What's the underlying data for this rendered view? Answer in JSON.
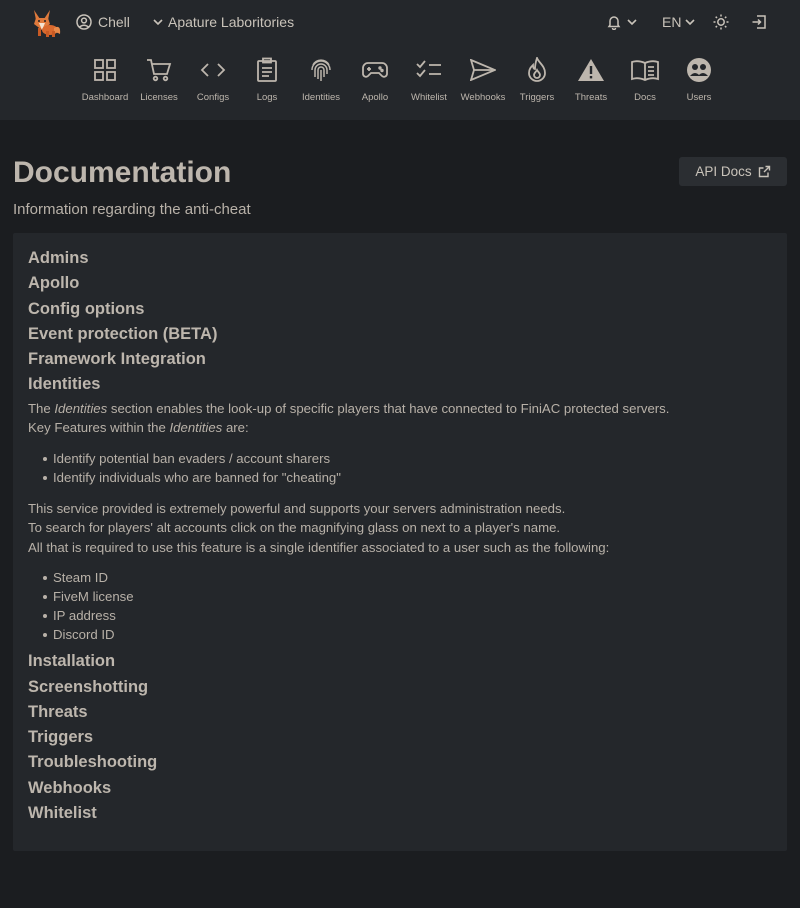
{
  "header": {
    "user_name": "Chell",
    "org_name": "Apature Laboritories",
    "language": "EN"
  },
  "nav": [
    {
      "key": "dashboard",
      "label": "Dashboard",
      "icon": "grid-icon"
    },
    {
      "key": "licenses",
      "label": "Licenses",
      "icon": "cart-icon"
    },
    {
      "key": "configs",
      "label": "Configs",
      "icon": "code-icon"
    },
    {
      "key": "logs",
      "label": "Logs",
      "icon": "clipboard-icon"
    },
    {
      "key": "identities",
      "label": "Identities",
      "icon": "fingerprint-icon"
    },
    {
      "key": "apollo",
      "label": "Apollo",
      "icon": "gamepad-icon"
    },
    {
      "key": "whitelist",
      "label": "Whitelist",
      "icon": "checklist-icon"
    },
    {
      "key": "webhooks",
      "label": "Webhooks",
      "icon": "send-icon"
    },
    {
      "key": "triggers",
      "label": "Triggers",
      "icon": "flame-icon"
    },
    {
      "key": "threats",
      "label": "Threats",
      "icon": "warning-icon"
    },
    {
      "key": "docs",
      "label": "Docs",
      "icon": "book-icon"
    },
    {
      "key": "users",
      "label": "Users",
      "icon": "users-icon"
    }
  ],
  "page": {
    "title": "Documentation",
    "subtitle": "Information regarding the anti-cheat",
    "api_docs_label": "API Docs"
  },
  "sections_before": [
    "Admins",
    "Apollo",
    "Config options",
    "Event protection (BETA)",
    "Framework Integration"
  ],
  "expanded": {
    "title": "Identities",
    "p1_pre": "The ",
    "p1_em": "Identities",
    "p1_post": " section enables the look-up of specific players that have connected to FiniAC protected servers.",
    "p2_pre": "Key Features within the ",
    "p2_em": "Identities",
    "p2_post": " are:",
    "features": [
      "Identify potential ban evaders / account sharers",
      "Identify individuals who are banned for \"cheating\""
    ],
    "p3": "This service provided is extremely powerful and supports your servers administration needs.",
    "p4": "To search for players' alt accounts click on the magnifying glass on next to a player's name.",
    "p5": "All that is required to use this feature is a single identifier associated to a user such as the following:",
    "identifiers": [
      "Steam ID",
      "FiveM license",
      "IP address",
      "Discord ID"
    ]
  },
  "sections_after": [
    "Installation",
    "Screenshotting",
    "Threats",
    "Triggers",
    "Troubleshooting",
    "Webhooks",
    "Whitelist"
  ],
  "colors": {
    "background": "#1b1d20",
    "panel": "#24272b",
    "text": "#bdb6ad",
    "fox": "#e07a3c"
  }
}
